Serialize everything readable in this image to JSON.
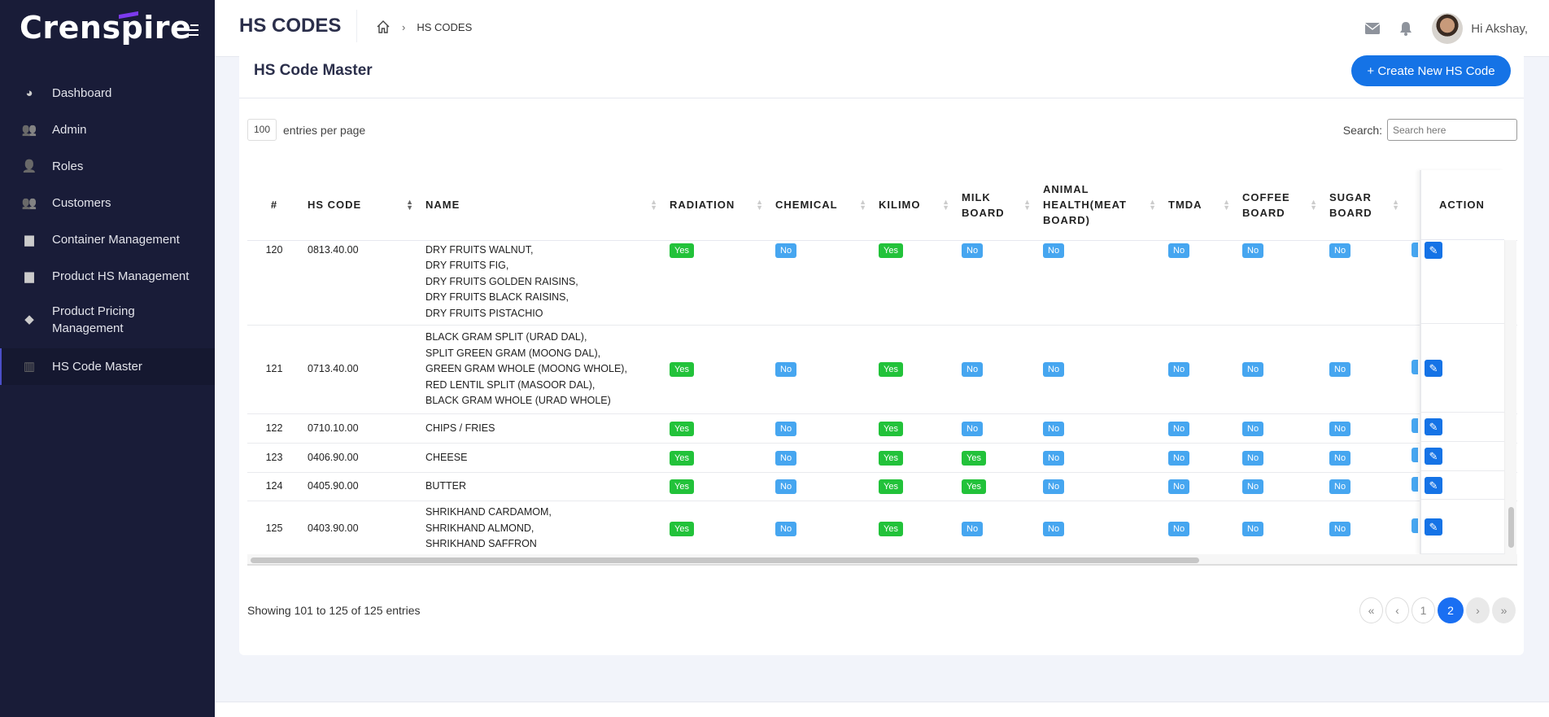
{
  "brand": "Crenspire",
  "sidebar": {
    "items": [
      {
        "label": "Dashboard",
        "icon": "dashboard-icon"
      },
      {
        "label": "Admin",
        "icon": "users-icon"
      },
      {
        "label": "Roles",
        "icon": "user-shield-icon"
      },
      {
        "label": "Customers",
        "icon": "users-icon"
      },
      {
        "label": "Container Management",
        "icon": "box-icon"
      },
      {
        "label": "Product HS Management",
        "icon": "box-icon"
      },
      {
        "label": "Product Pricing Management",
        "icon": "tag-icon"
      },
      {
        "label": "HS Code Master",
        "icon": "barcode-icon",
        "active": true
      }
    ]
  },
  "header": {
    "title": "HS CODES",
    "breadcrumb": "HS CODES",
    "greeting": "Hi Akshay,"
  },
  "card": {
    "title": "HS Code Master",
    "create_label": "+ Create New HS Code",
    "entries_value": "100",
    "entries_label": "entries per page",
    "search_label": "Search:",
    "search_placeholder": "Search here"
  },
  "table": {
    "columns": [
      "#",
      "HS CODE",
      "NAME",
      "RADIATION",
      "CHEMICAL",
      "KILIMO",
      "MILK BOARD",
      "ANIMAL HEALTH(MEAT BOARD)",
      "TMDA",
      "COFFEE BOARD",
      "SUGAR BOARD"
    ],
    "action_header": "ACTION",
    "rows": [
      {
        "id": "120",
        "code": "0813.40.00",
        "name": [
          "DRY FRUITS WALNUT,",
          "DRY FRUITS FIG,",
          "DRY FRUITS GOLDEN RAISINS,",
          "DRY FRUITS BLACK RAISINS,",
          "DRY FRUITS PISTACHIO"
        ],
        "flags": [
          "Yes",
          "No",
          "Yes",
          "No",
          "No",
          "No",
          "No",
          "No"
        ]
      },
      {
        "id": "121",
        "code": "0713.40.00",
        "name": [
          "BLACK GRAM SPLIT (URAD DAL),",
          "SPLIT GREEN GRAM (MOONG DAL),",
          "GREEN GRAM WHOLE (MOONG WHOLE),",
          "RED LENTIL SPLIT (MASOOR DAL),",
          "BLACK GRAM WHOLE (URAD WHOLE)"
        ],
        "flags": [
          "Yes",
          "No",
          "Yes",
          "No",
          "No",
          "No",
          "No",
          "No"
        ]
      },
      {
        "id": "122",
        "code": "0710.10.00",
        "name": [
          "CHIPS / FRIES"
        ],
        "flags": [
          "Yes",
          "No",
          "Yes",
          "No",
          "No",
          "No",
          "No",
          "No"
        ]
      },
      {
        "id": "123",
        "code": "0406.90.00",
        "name": [
          "CHEESE"
        ],
        "flags": [
          "Yes",
          "No",
          "Yes",
          "Yes",
          "No",
          "No",
          "No",
          "No"
        ]
      },
      {
        "id": "124",
        "code": "0405.90.00",
        "name": [
          "BUTTER"
        ],
        "flags": [
          "Yes",
          "No",
          "Yes",
          "Yes",
          "No",
          "No",
          "No",
          "No"
        ]
      },
      {
        "id": "125",
        "code": "0403.90.00",
        "name": [
          "SHRIKHAND CARDAMOM,",
          "SHRIKHAND ALMOND,",
          "SHRIKHAND SAFFRON"
        ],
        "flags": [
          "Yes",
          "No",
          "Yes",
          "No",
          "No",
          "No",
          "No",
          "No"
        ]
      }
    ]
  },
  "footer": {
    "info": "Showing 101 to 125 of 125 entries",
    "pages": [
      "«",
      "‹",
      "1",
      "2",
      "›",
      "»"
    ],
    "current_page": "2"
  }
}
